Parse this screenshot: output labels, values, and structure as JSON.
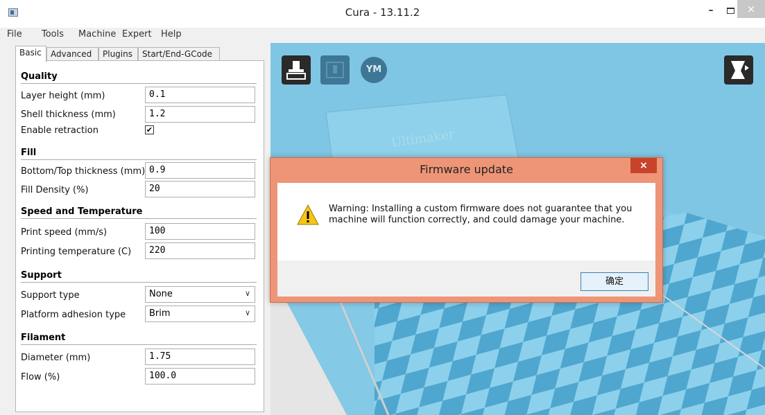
{
  "window": {
    "title": "Cura - 13.11.2",
    "minimize": "–",
    "close": "×"
  },
  "menu": [
    "File",
    "Tools",
    "Machine",
    "Expert",
    "Help"
  ],
  "tabs": [
    "Basic",
    "Advanced",
    "Plugins",
    "Start/End-GCode"
  ],
  "sections": {
    "quality": "Quality",
    "fill": "Fill",
    "speed": "Speed and Temperature",
    "support": "Support",
    "filament": "Filament"
  },
  "settings": {
    "layer_height": {
      "label": "Layer height (mm)",
      "value": "0.1"
    },
    "shell_thickness": {
      "label": "Shell thickness (mm)",
      "value": "1.2"
    },
    "enable_retraction": {
      "label": "Enable retraction",
      "checked": true,
      "mark": "✔"
    },
    "bottom_top_thickness": {
      "label": "Bottom/Top thickness (mm)",
      "value": "0.9"
    },
    "fill_density": {
      "label": "Fill Density (%)",
      "value": "20"
    },
    "print_speed": {
      "label": "Print speed (mm/s)",
      "value": "100"
    },
    "printing_temperature": {
      "label": "Printing temperature (C)",
      "value": "220"
    },
    "support_type": {
      "label": "Support type",
      "value": "None"
    },
    "platform_adhesion": {
      "label": "Platform adhesion type",
      "value": "Brim"
    },
    "diameter": {
      "label": "Diameter (mm)",
      "value": "1.75"
    },
    "flow": {
      "label": "Flow (%)",
      "value": "100.0"
    }
  },
  "viewport": {
    "ym_label": "YM",
    "machine_text": "Ultimaker",
    "colors": {
      "build_volume": "#7fc6e4",
      "checker_dark": "#4fa7cf",
      "checker_light": "#8cd0ec"
    }
  },
  "dialog": {
    "title": "Firmware update",
    "close": "×",
    "message": "Warning: Installing a custom firmware does not guarantee that you machine will function correctly, and could damage your machine.",
    "ok_label": "确定",
    "colors": {
      "frame": "#ee9577",
      "close": "#c7442a"
    }
  }
}
